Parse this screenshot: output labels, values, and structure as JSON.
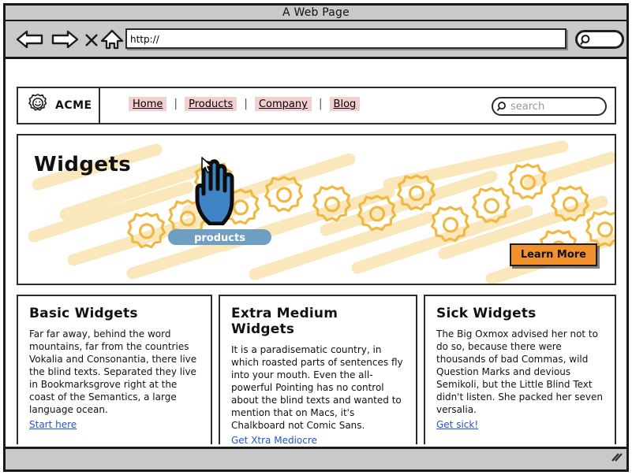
{
  "window": {
    "title": "A Web Page",
    "toolbar": {
      "back_icon": "back-arrow-icon",
      "forward_icon": "forward-arrow-icon",
      "stop_icon": "stop-x-icon",
      "home_icon": "home-house-icon",
      "url_value": "http://",
      "url_placeholder": "http://",
      "search_icon": "magnifier-icon"
    },
    "statusbar": {
      "text": ""
    }
  },
  "site": {
    "logo": {
      "icon": "gear-smiley-icon",
      "brand": "ACME"
    },
    "nav": {
      "separator": "|",
      "items": [
        {
          "label": "Home"
        },
        {
          "label": "Products"
        },
        {
          "label": "Company"
        },
        {
          "label": "Blog"
        }
      ]
    },
    "search": {
      "icon": "magnifier-icon",
      "placeholder": "search",
      "value": ""
    }
  },
  "hero": {
    "title": "Widgets",
    "cta_label": "Learn More",
    "art": {
      "stroke_color": "#fae6b8",
      "gear_color": "#f0b840",
      "gear_count": 14
    }
  },
  "tooltip": {
    "label": "products"
  },
  "cursor": {
    "hand_icon": "pointing-hand-cursor",
    "arrow_icon": "arrow-cursor"
  },
  "columns": [
    {
      "title": "Basic Widgets",
      "body": "Far far away, behind the word mountains, far from the countries Vokalia and Consonantia, there live the blind texts. Separated they live in Bookmarksgrove right at the coast of the Semantics, a large language ocean.",
      "link": "Start here"
    },
    {
      "title": "Extra Medium Widgets",
      "body": "It is a paradisematic country, in which roasted parts of sentences fly into your mouth. Even the all-powerful Pointing has no control about the blind texts and wanted to mention that on Macs, it's Chalkboard not Comic Sans.",
      "link": "Get Xtra Mediocre"
    },
    {
      "title": "Sick Widgets",
      "body": "The Big Oxmox advised her not to do so, because there were thousands of bad Commas, wild Question Marks and devious Semikoli, but the Little Blind Text didn't listen. She packed her seven versalia.",
      "link": "Get sick!"
    }
  ],
  "colors": {
    "chrome_gray": "#c9c9c9",
    "nav_highlight": "#f2cece",
    "cta_orange": "#f0912d",
    "tooltip_blue": "#6e9fc2",
    "link_blue": "#2255cc",
    "cursor_blue": "#3f85c6"
  }
}
